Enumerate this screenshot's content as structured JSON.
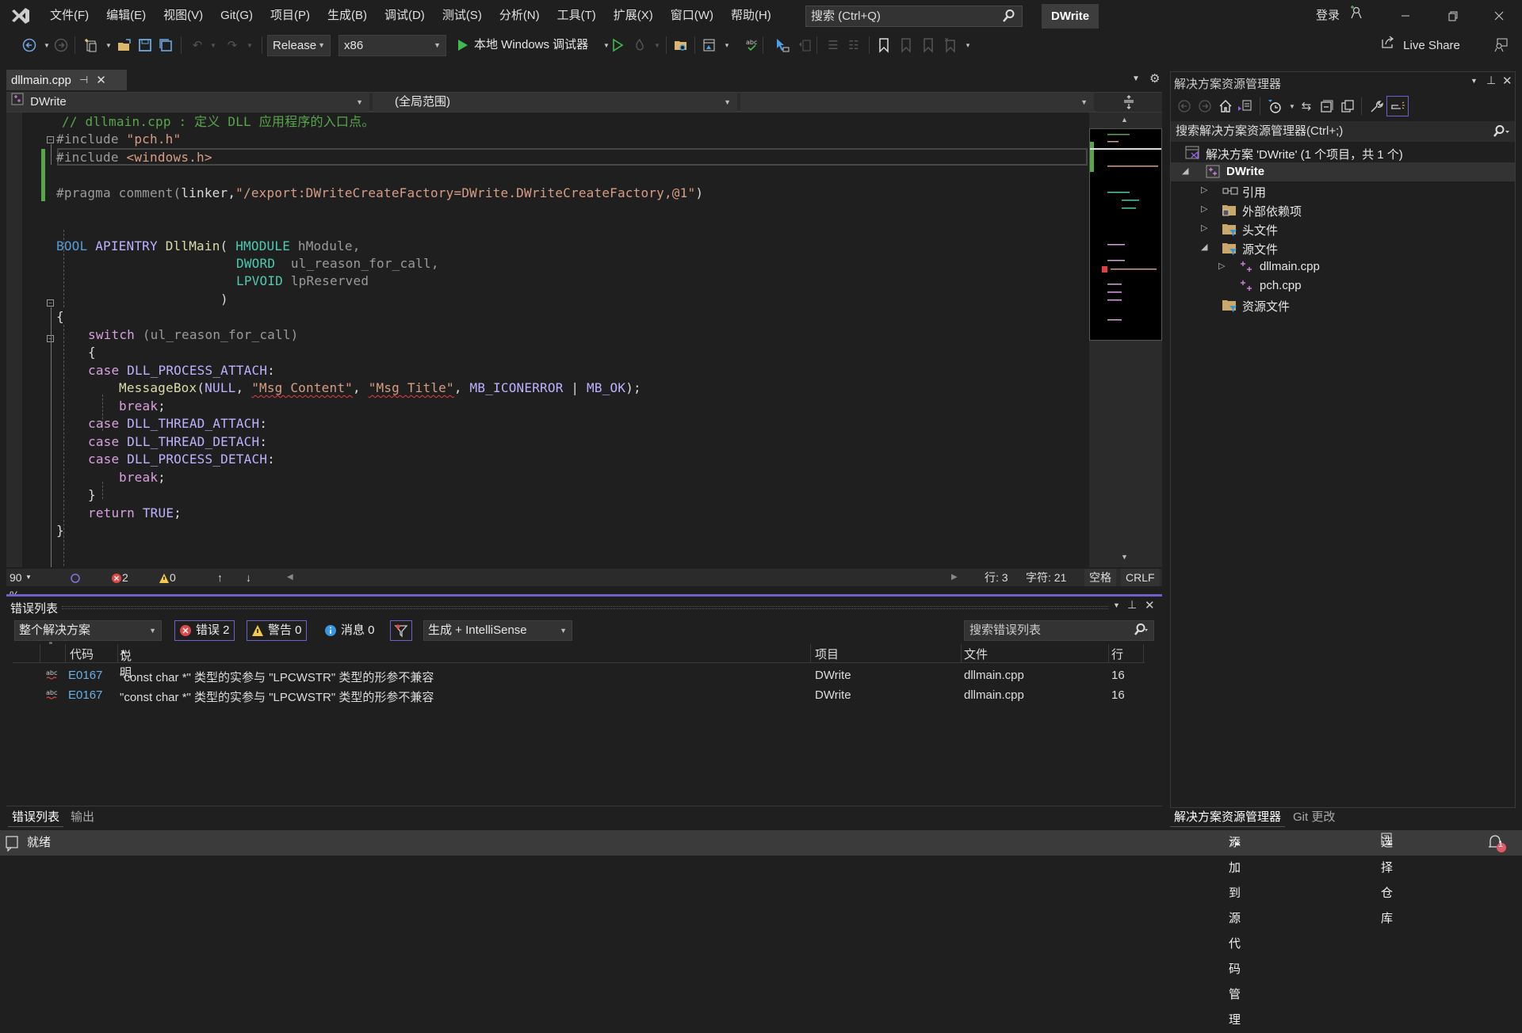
{
  "menubar": {
    "items": [
      "文件(F)",
      "编辑(E)",
      "视图(V)",
      "Git(G)",
      "项目(P)",
      "生成(B)",
      "调试(D)",
      "测试(S)",
      "分析(N)",
      "工具(T)",
      "扩展(X)",
      "窗口(W)",
      "帮助(H)"
    ],
    "search_placeholder": "搜索 (Ctrl+Q)",
    "solution_name": "DWrite",
    "login": "登录"
  },
  "toolbar": {
    "configuration": "Release",
    "platform": "x86",
    "run_label": "本地 Windows 调试器",
    "live_share": "Live Share"
  },
  "document": {
    "tab_label": "dllmain.cpp",
    "nav_project": "DWrite",
    "nav_scope": "(全局范围)",
    "nav_member": ""
  },
  "code": {
    "l1_comment": "// dllmain.cpp : 定义 DLL 应用程序的入口点。",
    "l2_pre": "#include ",
    "l2_str": "\"pch.h\"",
    "l3_pre": "#include ",
    "l3_str": "<windows.h>",
    "l5_pre": "#pragma comment(",
    "l5_arg": "linker",
    "l5_comma": ",",
    "l5_str": "\"/export:DWriteCreateFactory=DWrite.DWriteCreateFactory,@1\"",
    "l5_close": ")",
    "l8_bool": "BOOL",
    "l8_apientry": "APIENTRY",
    "l8_fn": "DllMain",
    "l8_paren": "( ",
    "l8_type": "HMODULE",
    "l8_param": " hModule,",
    "l9_type": "DWORD",
    "l9_param": "  ul_reason_for_call,",
    "l10_type": "LPVOID",
    "l10_param": " lpReserved",
    "l11": ")",
    "l12": "{",
    "l13_kw": "switch",
    "l13_rest": " (ul_reason_for_call)",
    "l14": "{",
    "l15_kw": "case",
    "l15_macro": " DLL_PROCESS_ATTACH",
    "l15_colon": ":",
    "l16_fn": "MessageBox",
    "l16_a": "(",
    "l16_null": "NULL",
    "l16_b": ", ",
    "l16_s1": "\"Msg Content\"",
    "l16_c": ", ",
    "l16_s2": "\"Msg Title\"",
    "l16_d": ", ",
    "l16_m1": "MB_ICONERROR",
    "l16_e": " | ",
    "l16_m2": "MB_OK",
    "l16_f": ");",
    "l17_kw": "break",
    "l17_semi": ";",
    "l18_kw": "case",
    "l18_macro": " DLL_THREAD_ATTACH",
    "l18_colon": ":",
    "l19_kw": "case",
    "l19_macro": " DLL_THREAD_DETACH",
    "l19_colon": ":",
    "l20_kw": "case",
    "l20_macro": " DLL_PROCESS_DETACH",
    "l20_colon": ":",
    "l21_kw": "break",
    "l21_semi": ";",
    "l22": "}",
    "l23_kw": "return",
    "l23_val": " TRUE",
    "l23_semi": ";",
    "l24": "}"
  },
  "editor_status": {
    "zoom": "90 %",
    "errors": "2",
    "warnings": "0",
    "line": "行: 3",
    "char": "字符: 21",
    "whitespace": "空格",
    "line_ending": "CRLF"
  },
  "error_list": {
    "title": "错误列表",
    "scope": "整个解决方案",
    "errors_filter": "错误 2",
    "warnings_filter": "警告 0",
    "messages_filter": "消息 0",
    "source": "生成 + IntelliSense",
    "search_placeholder": "搜索错误列表",
    "columns": [
      "代码",
      "说明",
      "项目",
      "文件",
      "行"
    ],
    "rows": [
      {
        "code": "E0167",
        "description": "\"const char *\" 类型的实参与 \"LPCWSTR\" 类型的形参不兼容",
        "project": "DWrite",
        "file": "dllmain.cpp",
        "line": "16"
      },
      {
        "code": "E0167",
        "description": "\"const char *\" 类型的实参与 \"LPCWSTR\" 类型的形参不兼容",
        "project": "DWrite",
        "file": "dllmain.cpp",
        "line": "16"
      }
    ]
  },
  "bottom_tabs": {
    "left": [
      "错误列表",
      "输出"
    ],
    "right": [
      "解决方案资源管理器",
      "Git 更改"
    ]
  },
  "solution_explorer": {
    "title": "解决方案资源管理器",
    "search_placeholder": "搜索解决方案资源管理器(Ctrl+;)",
    "solution_label": "解决方案 'DWrite' (1 个项目，共 1 个)",
    "project": "DWrite",
    "nodes": [
      "引用",
      "外部依赖项",
      "头文件",
      "源文件",
      "dllmain.cpp",
      "pch.cpp",
      "资源文件"
    ]
  },
  "statusbar": {
    "ready": "就绪",
    "add_source_control": "添加到源代码管理",
    "select_repo": "选择仓库",
    "notifications": "1"
  },
  "colors": {
    "accent": "#6e60c9",
    "error": "#e04848",
    "warning": "#f2c94c",
    "comment": "#57a64a",
    "string": "#d69d85"
  }
}
